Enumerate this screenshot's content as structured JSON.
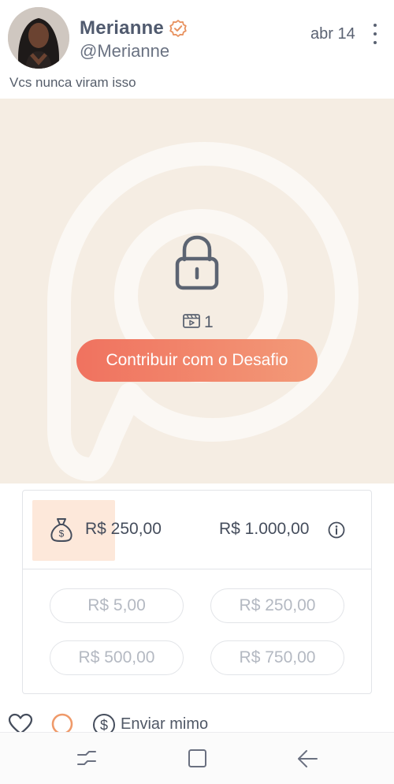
{
  "post": {
    "author_name": "Merianne",
    "handle": "@Merianne",
    "date": "abr 14",
    "caption": "Vcs nunca viram isso"
  },
  "media": {
    "locked": true,
    "clip_count": "1",
    "cta_label": "Contribuir com o Desafio"
  },
  "challenge": {
    "current_amount": "R$ 250,00",
    "goal_amount": "R$ 1.000,00",
    "progress_fraction": 0.25,
    "amount_options": [
      "R$ 5,00",
      "R$ 250,00",
      "R$ 500,00",
      "R$ 750,00"
    ]
  },
  "actions": {
    "tip_label": "Enviar mimo"
  },
  "icons": {
    "verified": "verified-badge-icon",
    "more": "more-vertical-icon",
    "lock": "lock-icon",
    "clip": "video-clip-icon",
    "money_bag": "money-bag-icon",
    "info": "info-icon",
    "like": "heart-icon",
    "comment": "circle-icon",
    "tip": "dollar-circle-icon",
    "nav_recent": "recent-apps-icon",
    "nav_home": "home-square-icon",
    "nav_back": "back-arrow-icon"
  },
  "colors": {
    "accent_start": "#f0725f",
    "accent_end": "#f39a78",
    "media_bg": "#f5ede3",
    "progress_fill": "#fde8da",
    "verified": "#e8915e"
  }
}
